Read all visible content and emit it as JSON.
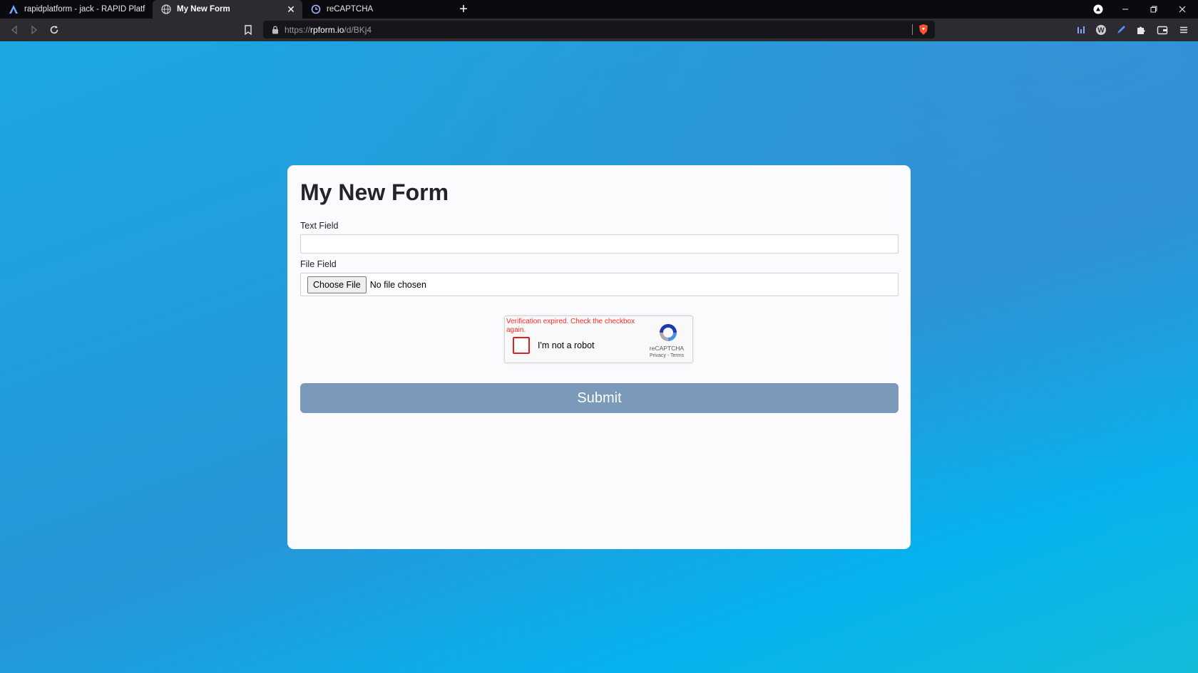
{
  "browser": {
    "tabs": [
      {
        "title": "rapidplatform - jack - RAPID Platform",
        "active": false,
        "icon": "rapid-logo-icon"
      },
      {
        "title": "My New Form",
        "active": true,
        "icon": "globe-icon"
      },
      {
        "title": "reCAPTCHA",
        "active": false,
        "icon": "recaptcha-icon"
      }
    ],
    "url": {
      "scheme": "https://",
      "host": "rpform.io",
      "path": "/d/BKj4"
    }
  },
  "form": {
    "title": "My New Form",
    "text_field_label": "Text Field",
    "text_field_value": "",
    "file_field_label": "File Field",
    "file_button_label": "Choose File",
    "file_status": "No file chosen",
    "submit_label": "Submit"
  },
  "captcha": {
    "error": "Verification expired. Check the checkbox again.",
    "label": "I'm not a robot",
    "brand": "reCAPTCHA",
    "links": "Privacy - Terms"
  },
  "colors": {
    "page_gradient_start": "#1aa7e2",
    "page_gradient_end": "#12bcd8",
    "submit_bg": "#7b99b8",
    "captcha_error": "#ff2b2b"
  }
}
